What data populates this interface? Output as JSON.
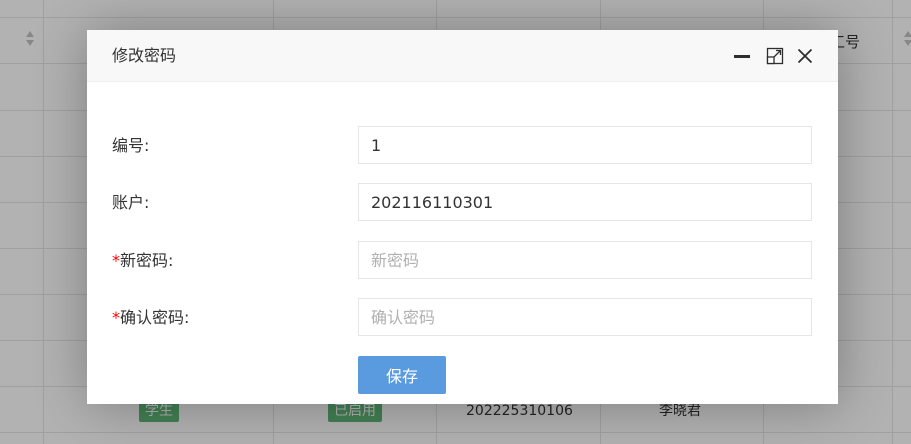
{
  "background_table": {
    "header_partial": "工号",
    "row": {
      "role_tag": "学生",
      "status_tag": "已启用",
      "account": "202225310106",
      "name": "李晓君"
    }
  },
  "dialog": {
    "title": "修改密码",
    "fields": [
      {
        "label": "编号:",
        "required": false,
        "value": "1",
        "placeholder": ""
      },
      {
        "label": "账户:",
        "required": false,
        "value": "202116110301",
        "placeholder": ""
      },
      {
        "label": "新密码:",
        "required": true,
        "value": "",
        "placeholder": "新密码"
      },
      {
        "label": "确认密码:",
        "required": true,
        "value": "",
        "placeholder": "确认密码"
      }
    ],
    "save_label": "保存",
    "required_mark": "*"
  },
  "colors": {
    "primary_button": "#5a9be0",
    "required": "#ff0000",
    "tag_green": "#5fb878"
  },
  "icons": {
    "minimize": "minimize-icon",
    "maximize": "maximize-icon",
    "close": "close-icon"
  }
}
